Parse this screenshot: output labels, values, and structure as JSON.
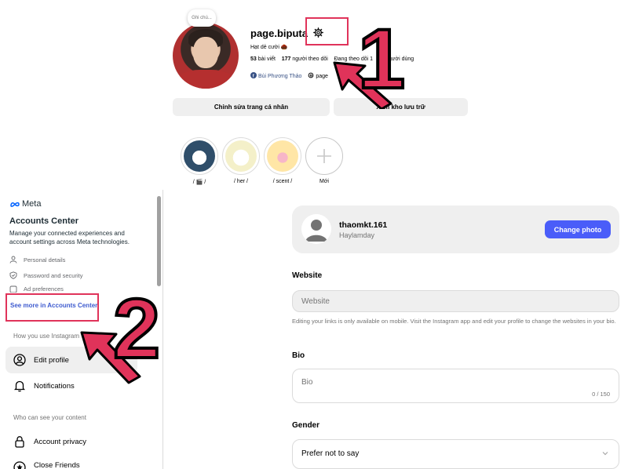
{
  "profile_header": {
    "note_bubble": "Ghi chú...",
    "username": "page.biputa",
    "bio": "Hạt dẻ cười 🌰",
    "posts_count": "53",
    "posts_label": "bài viết",
    "followers_count": "177",
    "followers_label": "người theo dõi",
    "following_label": "Đang theo dõi 1",
    "following_suffix": "người dùng",
    "facebook_link": "Bùi Phương Thảo",
    "threads_link": "page",
    "edit_profile_button": "Chỉnh sửa trang cá nhân",
    "view_archive_button": "Xem kho lưu trữ",
    "highlights": [
      {
        "label": "/ 🎬 /"
      },
      {
        "label": "/ her /"
      },
      {
        "label": "/ scent /"
      },
      {
        "label": "Mới"
      }
    ]
  },
  "annotations": {
    "number_1": "1",
    "number_2": "2",
    "accent_color": "#e0335a"
  },
  "sidebar": {
    "brand": "Meta",
    "accounts_center_title": "Accounts Center",
    "accounts_center_desc": "Manage your connected experiences and account settings across Meta technologies.",
    "items": [
      {
        "label": "Personal details",
        "icon": "person-icon"
      },
      {
        "label": "Password and security",
        "icon": "shield-icon"
      },
      {
        "label": "Ad preferences",
        "icon": "ad-icon"
      }
    ],
    "see_more": "See more in Accounts Center",
    "section_how": "How you use Instagram",
    "edit_profile": "Edit profile",
    "notifications": "Notifications",
    "section_who": "Who can see your content",
    "account_privacy": "Account privacy",
    "close_friends": "Close Friends"
  },
  "main": {
    "card_username": "thaomkt.161",
    "card_name": "Haylamday",
    "change_photo": "Change photo",
    "website_label": "Website",
    "website_placeholder": "Website",
    "website_note": "Editing your links is only available on mobile. Visit the Instagram app and edit your profile to change the websites in your bio.",
    "bio_label": "Bio",
    "bio_placeholder": "Bio",
    "bio_counter": "0 / 150",
    "gender_label": "Gender",
    "gender_value": "Prefer not to say",
    "primary_color": "#4a5df9"
  }
}
